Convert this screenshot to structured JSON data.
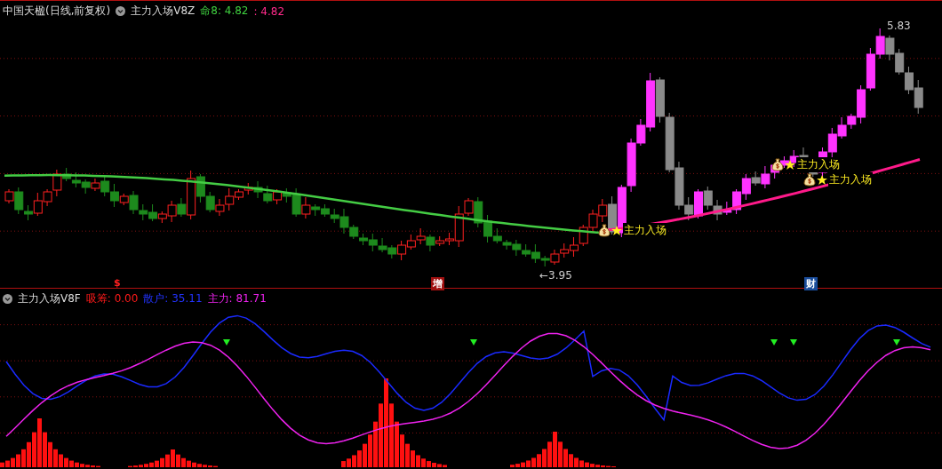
{
  "main_panel": {
    "title": "中国天楹(日线,前复权)",
    "indicator": "主力入场V8Z",
    "readings": [
      {
        "text": "命8: 4.82",
        "color": "#3fcf3f"
      },
      {
        "text": ": 4.82",
        "color": "#ff2a8a"
      }
    ],
    "signals": [
      {
        "text": "主力入场"
      },
      {
        "text": "主力入场"
      },
      {
        "text": "主力入场"
      }
    ],
    "high_label": "5.83",
    "low_label": "←3.95",
    "markers": [
      {
        "text": "$",
        "kind": "plain",
        "color": "#ff2020"
      },
      {
        "text": "增",
        "kind": "tag",
        "color": "#a01010"
      },
      {
        "text": "财",
        "kind": "tag",
        "color": "#1a4c9a"
      }
    ]
  },
  "sub_panel": {
    "indicator": "主力入场V8F",
    "readings": [
      {
        "label": "吸筹:",
        "value": "0.00",
        "color": "#ff1a1a"
      },
      {
        "label": "散户:",
        "value": "35.11",
        "color": "#2233ff"
      },
      {
        "label": "主力:",
        "value": "81.71",
        "color": "#ee22ee"
      }
    ]
  }
}
